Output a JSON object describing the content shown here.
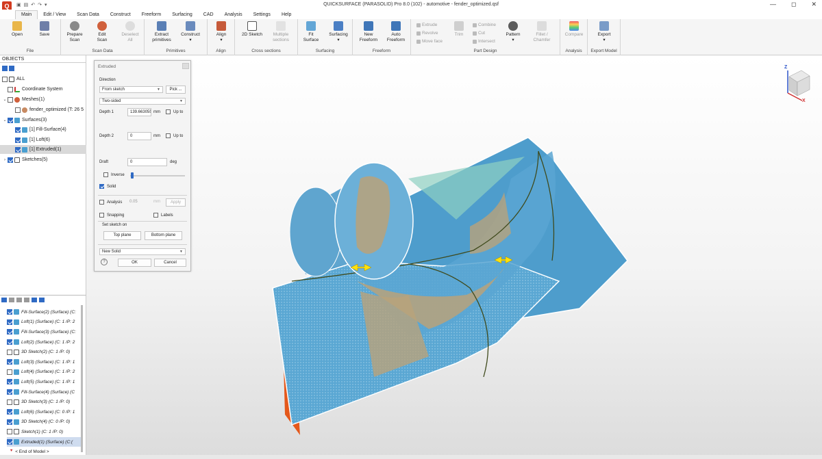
{
  "window": {
    "logo": "Q",
    "title": "QUICKSURFACE (PARASOLID) Pro 8.0 (102) - automotive - fender_optimized.qsf",
    "qat": [
      "save-icon",
      "save-as-icon",
      "undo-icon",
      "redo-icon",
      "customize-icon"
    ],
    "controls": {
      "minimize": "—",
      "maximize": "◻",
      "close": "✕"
    }
  },
  "menu": [
    "Main",
    "Edit / View",
    "Scan Data",
    "Construct",
    "Freeform",
    "Surfacing",
    "CAD",
    "Analysis",
    "Settings",
    "Help"
  ],
  "ribbon": {
    "file": {
      "label": "File",
      "open": "Open",
      "save": "Save"
    },
    "scan_data": {
      "label": "Scan Data",
      "prepare": "Prepare Scan",
      "edit": "Edit Scan",
      "deselect": "Deselect All"
    },
    "primitives": {
      "label": "Primitives",
      "extract": "Extract primitives",
      "construct": "Construct"
    },
    "align": {
      "label": "Align",
      "align": "Align"
    },
    "cross_sections": {
      "label": "Cross sections",
      "sketch2d": "2D Sketch",
      "multiple": "Multiple sections"
    },
    "surfacing": {
      "label": "Surfacing",
      "fit": "Fit Surface",
      "surfacing": "Surfacing"
    },
    "freeform": {
      "label": "Freeform",
      "new": "New Freeform",
      "auto": "Auto Freeform"
    },
    "part_design": {
      "label": "Part Design",
      "extrude": "Extrude",
      "revolve": "Revolve",
      "move_face": "Move face",
      "trim": "Trim",
      "combine": "Combine",
      "cut": "Cut",
      "intersect": "Intersect",
      "pattern": "Pattern",
      "fillet": "Fillet / Chamfer"
    },
    "analysis": {
      "label": "Analysis",
      "compare": "Compare"
    },
    "export_model": {
      "label": "Export Model",
      "export": "Export"
    }
  },
  "objects": {
    "header": "OBJECTS",
    "all": "ALL",
    "coord": "Coordinate System",
    "meshes": "Meshes(1)",
    "fender": "fender_optimized (T: 26 5",
    "surfaces": "Surfaces(3)",
    "fill": "[1] Fill-Surface(4)",
    "loft": "[1] Loft(6)",
    "extruded": "[1] Extruded(1)",
    "sketches": "Sketches(5)"
  },
  "history": {
    "items": [
      "Fill-Surface(2) (Surface) (C:",
      "Loft(1) (Surface) (C: 1 /P: 2",
      "Fill-Surface(3) (Surface) (C:",
      "Loft(2) (Surface) (C: 1 /P: 2",
      "3D Sketch(2) (C: 1 /P: 0)",
      "Loft(3) (Surface) (C: 1 /P: 1",
      "Loft(4) (Surface) (C: 1 /P: 2",
      "Loft(5) (Surface) (C: 1 /P: 1",
      "Fill-Surface(4) (Surface) (C",
      "3D Sketch(3) (C: 1 /P: 0)",
      "Loft(6) (Surface) (C: 0 /P: 1",
      "3D Sketch(4) (C: 0 /P: 0)",
      "Sketch(1) (C: 1 /P: 0)",
      "Extruded(1) (Surface) (C:("
    ],
    "end": "< End of Model >"
  },
  "dialog": {
    "title": "Extruded",
    "direction_label": "Direction",
    "direction_value": "From sketch",
    "pick": "Pick ...",
    "sided_value": "Two-sided",
    "depth1_label": "Depth 1",
    "depth1_value": "139.663055",
    "unit_mm": "mm",
    "up_to": "Up to",
    "depth2_label": "Depth 2",
    "depth2_value": "0",
    "draft_label": "Draft",
    "draft_value": "0",
    "unit_deg": "deg",
    "inverse": "Inverse",
    "solid": "Solid",
    "analysis": "Analysis",
    "analysis_value": "0.05",
    "apply": "Apply",
    "snapping": "Snapping",
    "labels": "Labels",
    "set_sketch_on": "Set sketch on",
    "top_plane": "Top plane",
    "bottom_plane": "Bottom plane",
    "operation_value": "New Solid",
    "help": "?",
    "ok": "OK",
    "cancel": "Cancel"
  },
  "viewcube": {
    "z": "Z",
    "x": "X"
  },
  "colors": {
    "accent": "#2f6ac4",
    "surface_blue": "#4a9fd0",
    "orange": "#e4581b",
    "mesh_tan": "#b9a27a",
    "logo_red": "#d23a1f"
  }
}
